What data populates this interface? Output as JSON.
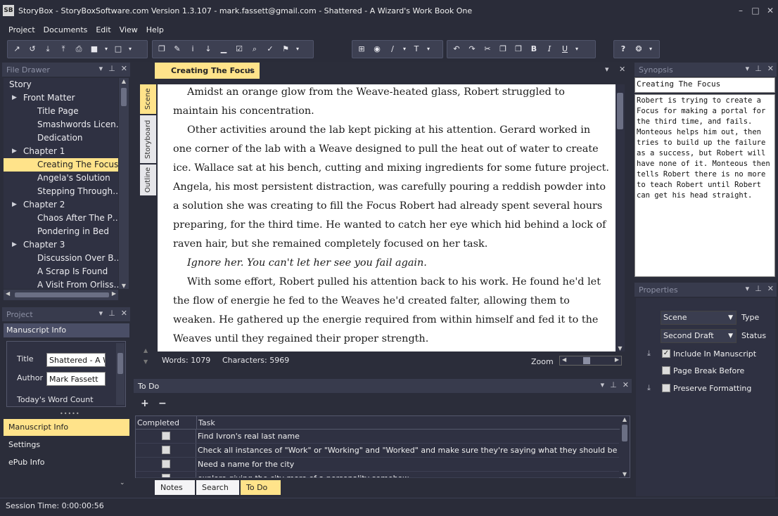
{
  "window": {
    "title": "StoryBox - StoryBoxSoftware.com Version 1.3.107 - mark.fassett@gmail.com - Shattered - A Wizard's Work Book One",
    "app_icon_text": "SB",
    "minimize": "–",
    "maximize": "□",
    "close": "✕"
  },
  "menu": [
    "Project",
    "Documents",
    "Edit",
    "View",
    "Help"
  ],
  "toolbar": {
    "group1": [
      "↗",
      "↺",
      "⤓",
      "⤒",
      "⎙",
      "■",
      "▾",
      "□",
      "▾"
    ],
    "group2": [
      "❐",
      "✎",
      "i",
      "↓",
      "▁",
      "☑",
      "⌕",
      "✓",
      "⚑",
      "▾"
    ],
    "group3": [
      "⊞",
      "◉",
      "∕",
      "▾",
      "T",
      "▾"
    ],
    "group4": [
      "↶",
      "↷",
      "✂",
      "❐",
      "❐",
      "B",
      "I",
      "U",
      "▾"
    ],
    "group5": [
      "?",
      "❂",
      "▾"
    ]
  },
  "file_drawer": {
    "title": "File Drawer",
    "items": [
      {
        "label": "Story",
        "level": 0,
        "expander": ""
      },
      {
        "label": "Front Matter",
        "level": 1,
        "expander": "▶"
      },
      {
        "label": "Title Page",
        "level": 2,
        "expander": ""
      },
      {
        "label": "Smashwords Licen…",
        "level": 2,
        "expander": ""
      },
      {
        "label": "Dedication",
        "level": 2,
        "expander": ""
      },
      {
        "label": "Chapter 1",
        "level": 1,
        "expander": "▶"
      },
      {
        "label": "Creating The Focus",
        "level": 2,
        "expander": "",
        "selected": true
      },
      {
        "label": "Angela's Solution",
        "level": 2,
        "expander": ""
      },
      {
        "label": "Stepping Through…",
        "level": 2,
        "expander": ""
      },
      {
        "label": "Chapter 2",
        "level": 1,
        "expander": "▶"
      },
      {
        "label": "Chaos After The P…",
        "level": 2,
        "expander": ""
      },
      {
        "label": "Pondering in Bed",
        "level": 2,
        "expander": ""
      },
      {
        "label": "Chapter 3",
        "level": 1,
        "expander": "▶"
      },
      {
        "label": "Discussion Over B…",
        "level": 2,
        "expander": ""
      },
      {
        "label": "A Scrap Is Found",
        "level": 2,
        "expander": ""
      },
      {
        "label": "A Visit From Orliss…",
        "level": 2,
        "expander": ""
      }
    ]
  },
  "project_panel": {
    "title": "Project",
    "section": "Manuscript Info",
    "title_label": "Title",
    "title_value": "Shattered - A W",
    "author_label": "Author",
    "author_value": "Mark Fassett",
    "word_count_label": "Today's Word Count",
    "nav": [
      "Manuscript Info",
      "Settings",
      "ePub Info"
    ]
  },
  "document": {
    "tab": "Creating The Focus",
    "tab_close": "✕",
    "side_tabs": [
      "Scene",
      "Storyboard",
      "Outline"
    ],
    "paragraphs": [
      {
        "text": "Amidst an orange glow from the Weave-heated glass, Robert struggled to maintain his concentration.",
        "italic": false
      },
      {
        "text": "Other activities around the lab kept picking at his attention. Gerard worked in one corner of the lab with a Weave designed to pull the heat out of water to create ice. Wallace sat at his bench, cutting and mixing ingredients for some future project. Angela, his most persistent distraction, was carefully pouring a reddish powder into a solution she was creating to fill the Focus Robert had already spent several hours preparing, for the third time. He wanted to catch her eye which hid behind a lock of raven hair, but she remained completely focused on her task.",
        "italic": false
      },
      {
        "text": "Ignore her. You can't let her see you fail again.",
        "italic": true
      },
      {
        "text": "With some effort, Robert pulled his attention back to his work. He found he'd let the flow of energie he fed to the Weaves he'd created falter, allowing them to weaken. He gathered up the energie required from within himself and fed it to the Weaves until they regained their proper strength.",
        "italic": false
      }
    ],
    "words": "Words: 1079",
    "characters": "Characters: 5969",
    "zoom_label": "Zoom"
  },
  "todo": {
    "title": "To Do",
    "add": "+",
    "remove": "−",
    "col_completed": "Completed",
    "col_task": "Task",
    "rows": [
      "Find Ivron's real last name",
      "Check all instances of \"Work\" or \"Working\" and \"Worked\" and make sure they're saying what they should be saying",
      "Need a name for the city",
      "explore giving the city more of a personality somehow"
    ],
    "bottom_tabs": [
      "Notes",
      "Search",
      "To Do"
    ]
  },
  "synopsis": {
    "title": "Synopsis",
    "heading": "Creating The Focus",
    "text": "Robert is trying to create a Focus for making a portal for the third time, and fails. Monteous helps him out, then tries to build up the failure as a success, but Robert will have none of it. Monteous then tells Robert there is no more to teach Robert until Robert can get his head straight."
  },
  "properties": {
    "title": "Properties",
    "type_value": "Scene",
    "type_label": "Type",
    "status_value": "Second Draft",
    "status_label": "Status",
    "include_label": "Include In Manuscript",
    "include_checked": true,
    "page_break_label": "Page Break Before",
    "preserve_label": "Preserve Formatting"
  },
  "status_bar": {
    "session_time": "Session Time: 0:00:00:56"
  }
}
